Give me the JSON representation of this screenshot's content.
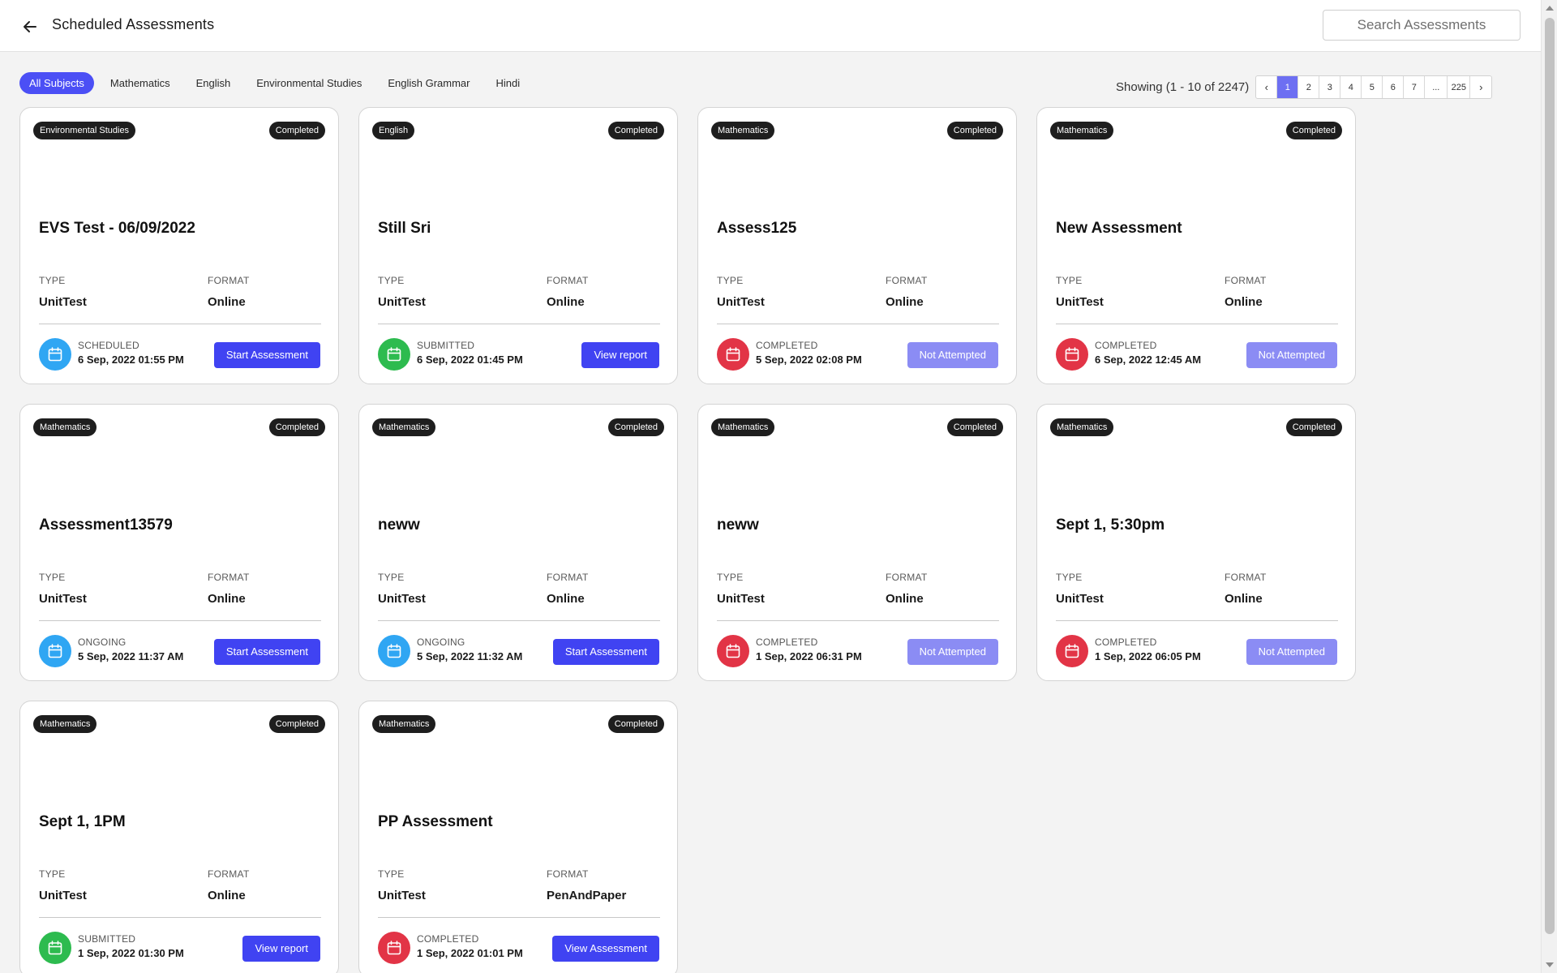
{
  "header": {
    "title": "Scheduled Assessments",
    "search_placeholder": "Search Assessments"
  },
  "filters": [
    "All Subjects",
    "Mathematics",
    "English",
    "Environmental Studies",
    "English Grammar",
    "Hindi"
  ],
  "active_filter": "All Subjects",
  "pagination": {
    "showing": "Showing (1 - 10 of 2247)",
    "pages": [
      "1",
      "2",
      "3",
      "4",
      "5",
      "6",
      "7",
      "...",
      "225"
    ],
    "current": "1",
    "prev_icon": "‹",
    "next_icon": "›"
  },
  "labels": {
    "type": "TYPE",
    "format": "FORMAT"
  },
  "colors": {
    "accent": "#4043f2",
    "accent_disabled": "#8b8cf4",
    "calendar_blue": "#2fa6f3",
    "calendar_green": "#2dbb4f",
    "calendar_red": "#e23446"
  },
  "cards": [
    {
      "subject": "Environmental Studies",
      "status": "Completed",
      "title": "EVS Test - 06/09/2022",
      "type": "UnitTest",
      "format": "Online",
      "state": "SCHEDULED",
      "date": "6 Sep, 2022 01:55 PM",
      "icon_color": "blue",
      "action": "Start Assessment",
      "action_disabled": false
    },
    {
      "subject": "English",
      "status": "Completed",
      "title": "Still Sri",
      "type": "UnitTest",
      "format": "Online",
      "state": "SUBMITTED",
      "date": "6 Sep, 2022 01:45 PM",
      "icon_color": "green",
      "action": "View report",
      "action_disabled": false
    },
    {
      "subject": "Mathematics",
      "status": "Completed",
      "title": "Assess125",
      "type": "UnitTest",
      "format": "Online",
      "state": "COMPLETED",
      "date": "5 Sep, 2022 02:08 PM",
      "icon_color": "red",
      "action": "Not Attempted",
      "action_disabled": true
    },
    {
      "subject": "Mathematics",
      "status": "Completed",
      "title": "New Assessment",
      "type": "UnitTest",
      "format": "Online",
      "state": "COMPLETED",
      "date": "6 Sep, 2022 12:45 AM",
      "icon_color": "red",
      "action": "Not Attempted",
      "action_disabled": true
    },
    {
      "subject": "Mathematics",
      "status": "Completed",
      "title": "Assessment13579",
      "type": "UnitTest",
      "format": "Online",
      "state": "ONGOING",
      "date": "5 Sep, 2022 11:37 AM",
      "icon_color": "blue",
      "action": "Start Assessment",
      "action_disabled": false
    },
    {
      "subject": "Mathematics",
      "status": "Completed",
      "title": "neww",
      "type": "UnitTest",
      "format": "Online",
      "state": "ONGOING",
      "date": "5 Sep, 2022 11:32 AM",
      "icon_color": "blue",
      "action": "Start Assessment",
      "action_disabled": false
    },
    {
      "subject": "Mathematics",
      "status": "Completed",
      "title": "neww",
      "type": "UnitTest",
      "format": "Online",
      "state": "COMPLETED",
      "date": "1 Sep, 2022 06:31 PM",
      "icon_color": "red",
      "action": "Not Attempted",
      "action_disabled": true
    },
    {
      "subject": "Mathematics",
      "status": "Completed",
      "title": "Sept 1, 5:30pm",
      "type": "UnitTest",
      "format": "Online",
      "state": "COMPLETED",
      "date": "1 Sep, 2022 06:05 PM",
      "icon_color": "red",
      "action": "Not Attempted",
      "action_disabled": true
    },
    {
      "subject": "Mathematics",
      "status": "Completed",
      "title": "Sept 1, 1PM",
      "type": "UnitTest",
      "format": "Online",
      "state": "SUBMITTED",
      "date": "1 Sep, 2022 01:30 PM",
      "icon_color": "green",
      "action": "View report",
      "action_disabled": false
    },
    {
      "subject": "Mathematics",
      "status": "Completed",
      "title": "PP Assessment",
      "type": "UnitTest",
      "format": "PenAndPaper",
      "state": "COMPLETED",
      "date": "1 Sep, 2022 01:01 PM",
      "icon_color": "red",
      "action": "View Assessment",
      "action_disabled": false
    }
  ]
}
